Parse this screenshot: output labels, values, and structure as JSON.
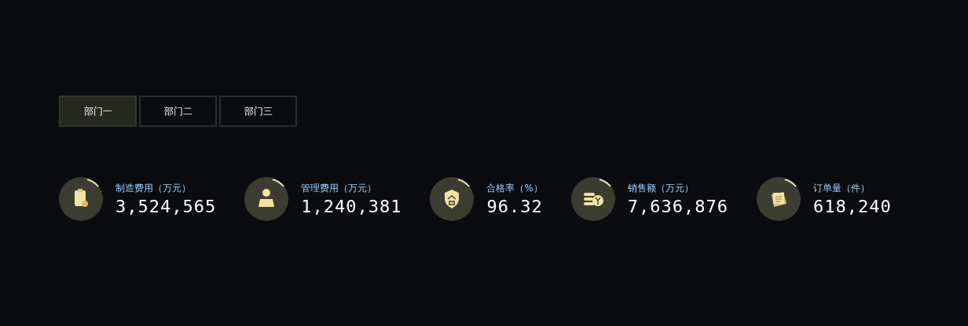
{
  "tabs": [
    {
      "label": "部门一",
      "selected": true
    },
    {
      "label": "部门二",
      "selected": false
    },
    {
      "label": "部门三",
      "selected": false
    }
  ],
  "stats": [
    {
      "kind": "clipboard",
      "label": "制造费用（万元）",
      "value": "3,524,565"
    },
    {
      "kind": "person",
      "label": "管理费用（万元）",
      "value": "1,240,381"
    },
    {
      "kind": "shield",
      "label": "合格率（%）",
      "value": "96.32"
    },
    {
      "kind": "coins",
      "label": "销售额（万元）",
      "value": "7,636,876"
    },
    {
      "kind": "notes",
      "label": "订单量（件）",
      "value": "618,240"
    }
  ]
}
